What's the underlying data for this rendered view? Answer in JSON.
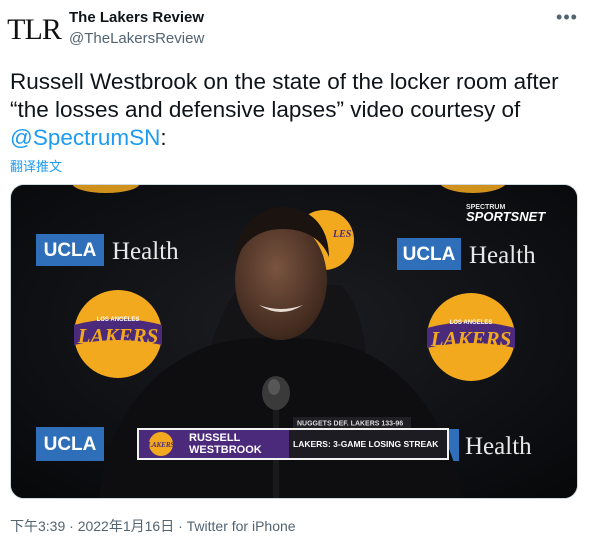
{
  "account": {
    "avatar_text": "TLR",
    "display_name": "The Lakers Review",
    "handle": "@TheLakersReview"
  },
  "tweet": {
    "text_before": "Russell Westbrook on the state of the locker room after “the losses and defensive lapses” video courtesy of ",
    "mention": "@SpectrumSN",
    "text_after": ":",
    "translate_label": "翻译推文"
  },
  "video": {
    "backdrop": {
      "ucla_label": "UCLA",
      "health_label": "Health",
      "lakers_top_label": "LOS ANGELES",
      "lakers_label": "LAKERS",
      "lakers_fragment": "LES",
      "broadcaster_top": "SPECTRUM",
      "broadcaster": "SPORTSNET"
    },
    "lower_third": {
      "score_bar": "NUGGETS DEF. LAKERS 133-96",
      "logo_label": "LAKERS",
      "first_name": "RUSSELL",
      "last_name": "WESTBROOK",
      "headline": "LAKERS: 3-GAME LOSING STREAK"
    }
  },
  "meta": {
    "timestamp": "下午3:39 · 2022年1月16日 · Twitter for iPhone"
  },
  "colors": {
    "text": "#0f1419",
    "secondary": "#536471",
    "link": "#1d9bf0",
    "ucla_blue": "#2f6eb8",
    "lakers_purple": "#4b2a7b",
    "lakers_gold": "#f3a91e"
  },
  "icons": {
    "more": "more-options-icon"
  }
}
